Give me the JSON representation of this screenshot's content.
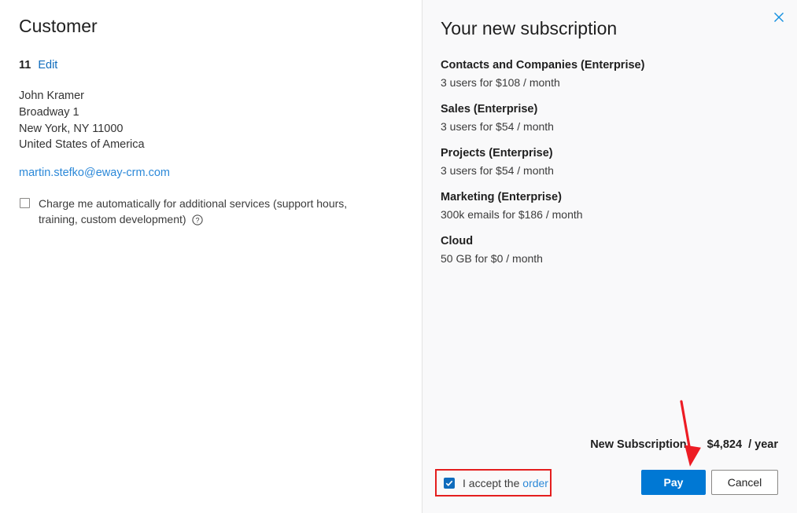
{
  "customer": {
    "heading": "Customer",
    "id": "11",
    "edit_label": "Edit",
    "address_lines": [
      "John Kramer",
      "Broadway 1",
      "New York, NY 11000",
      "United States of America"
    ],
    "email": "martin.stefko@eway-crm.com",
    "charge_checkbox": {
      "checked": false,
      "label": "Charge me automatically for additional services (support hours, training, custom development)",
      "help_icon": "question-circle-icon"
    }
  },
  "subscription": {
    "heading": "Your new subscription",
    "close_icon": "close-icon",
    "items": [
      {
        "name": "Contacts and Companies (Enterprise)",
        "detail": "3 users for $108 / month"
      },
      {
        "name": "Sales (Enterprise)",
        "detail": "3 users for $54 / month"
      },
      {
        "name": "Projects (Enterprise)",
        "detail": "3 users for $54 / month"
      },
      {
        "name": "Marketing (Enterprise)",
        "detail": "300k emails for $186 / month"
      },
      {
        "name": "Cloud",
        "detail": "50 GB for $0 / month"
      }
    ],
    "total": {
      "label": "New Subscription",
      "amount": "$4,824",
      "period": "/ year"
    },
    "accept": {
      "checked": true,
      "text_before": "I accept the",
      "link_label": "order"
    },
    "buttons": {
      "pay": "Pay",
      "cancel": "Cancel"
    }
  },
  "annotations": {
    "arrow_color": "#ed1c24",
    "highlight_color": "#e41e1e"
  },
  "colors": {
    "accent_blue": "#0078d4",
    "link_blue": "#2b88d8",
    "panel_bg": "#f9f9fa"
  }
}
